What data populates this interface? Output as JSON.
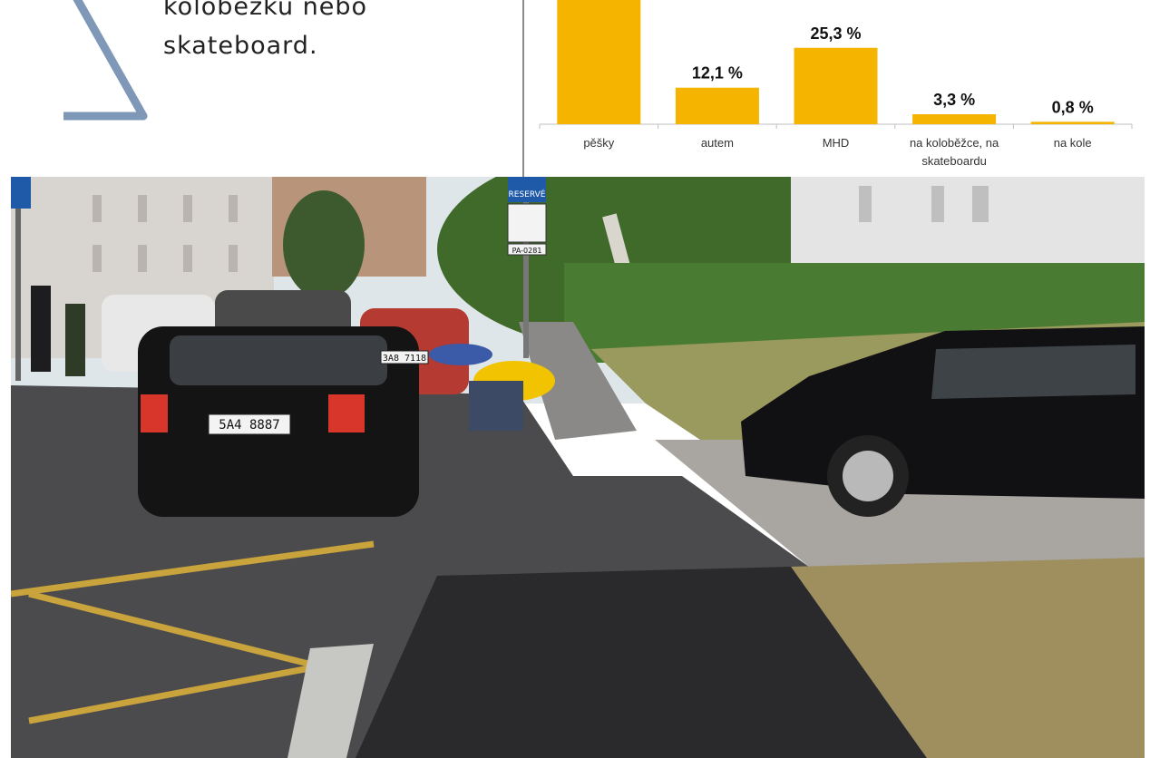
{
  "slide": {
    "text_lines": [
      "koloběžku nebo",
      "skateboard."
    ]
  },
  "chart_data": {
    "type": "bar",
    "categories": [
      "pěšky",
      "autem",
      "MHD",
      "na koloběžce, na skateboardu",
      "na kole"
    ],
    "category_lines": [
      [
        "pěšky"
      ],
      [
        "autem"
      ],
      [
        "MHD"
      ],
      [
        "na koloběžce, na",
        "skateboardu"
      ],
      [
        "na kole"
      ]
    ],
    "values": [
      null,
      12.1,
      25.3,
      3.3,
      0.8
    ],
    "data_labels": [
      "",
      "12,1 %",
      "25,3 %",
      "3,3 %",
      "0,8 %"
    ],
    "bar_color": "#f5b400",
    "title": "",
    "xlabel": "",
    "ylabel": "",
    "grid": false,
    "legend": "none"
  },
  "photo": {
    "sign_top": "RESERVÉ",
    "sign_plate": "PA-0281",
    "plate_left_car": "5A4 8887",
    "plate_red_car": "3A8 7118"
  },
  "colors": {
    "triangle": "#7f98b8",
    "axis": "#bfbfbf",
    "label_text": "#333333"
  }
}
